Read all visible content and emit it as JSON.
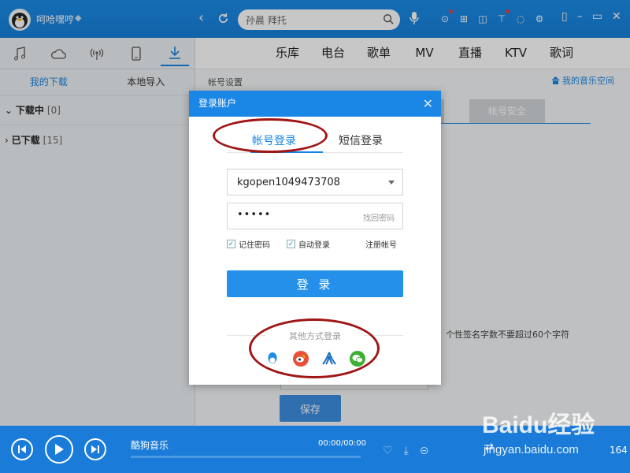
{
  "topbar": {
    "username": "呵哈嘿哼",
    "search_text": "孙晨 拜托",
    "icons": [
      "play-circle-icon",
      "apps-icon",
      "game-icon",
      "shirt-icon",
      "bulb-icon",
      "gear-icon"
    ],
    "window_controls": [
      "mini-mode-icon",
      "minimize-icon",
      "restore-icon",
      "close-icon"
    ],
    "accent": "#1a87e6"
  },
  "left": {
    "tabs": [
      "music-icon",
      "cloud-icon",
      "radio-icon",
      "device-icon",
      "download-icon"
    ],
    "sub_tabs": [
      "我的下载",
      "本地导入"
    ],
    "groups": [
      {
        "name": "下载中",
        "count": "[0]"
      },
      {
        "name": "已下载",
        "count": "[15]"
      }
    ]
  },
  "main": {
    "nav": [
      "乐库",
      "电台",
      "歌单",
      "MV",
      "直播",
      "KTV",
      "歌词"
    ],
    "breadcrumb": "帐号设置",
    "home_link": "我的音乐空间",
    "tabs": [
      "",
      "帐号安全"
    ],
    "hint": "个性签名字数不要超过60个字符",
    "save": "保存"
  },
  "player": {
    "song": "酷狗音乐",
    "time": "00:00/00:00",
    "progress": 0,
    "count": "164"
  },
  "dialog": {
    "title": "登录账户",
    "tab_account": "帐号登录",
    "tab_sms": "短信登录",
    "username": "kgopen1049473708",
    "password_mask": "•••••",
    "forgot": "找回密码",
    "remember": "记住密码",
    "auto_login": "自动登录",
    "register": "注册帐号",
    "login": "登 录",
    "other": "其他方式登录",
    "social": [
      "qq-icon",
      "weibo-icon",
      "renren-icon",
      "wechat-icon"
    ]
  },
  "watermark": {
    "brand": "Baidu经验",
    "sub": "jingyan.baidu.com"
  }
}
